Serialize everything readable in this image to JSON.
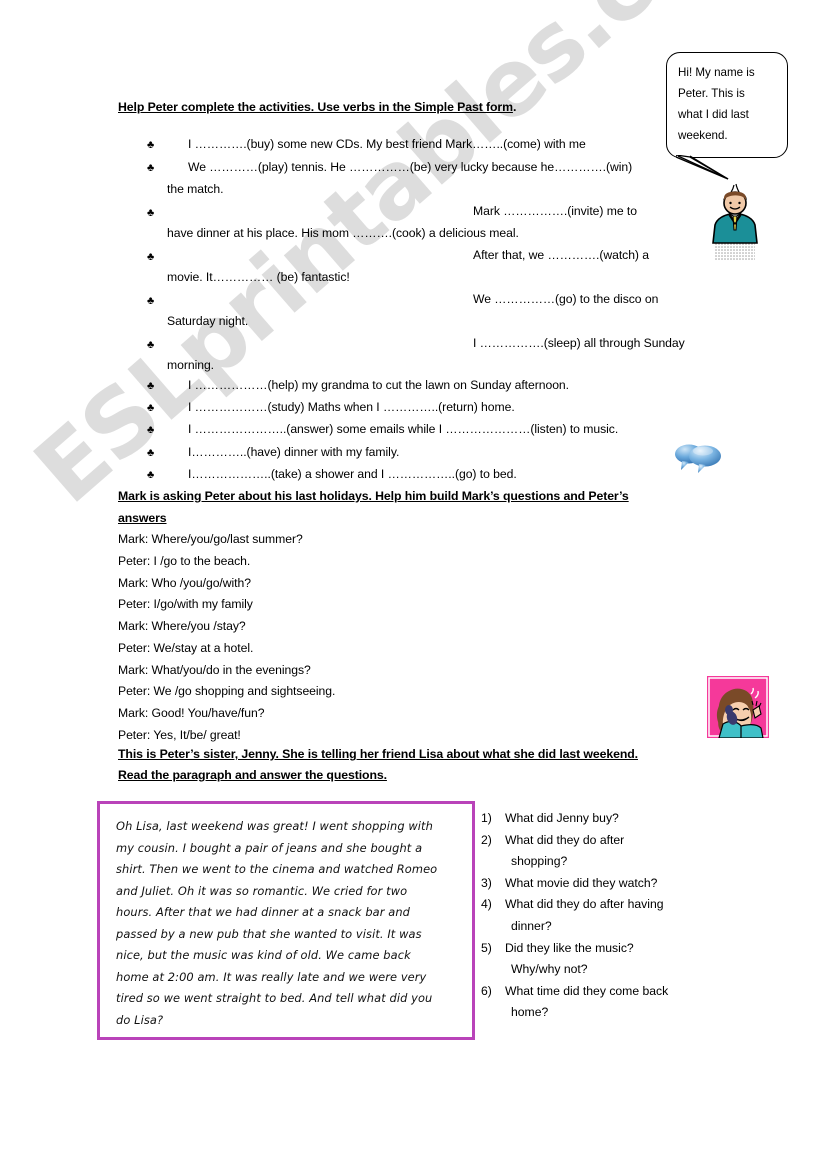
{
  "speech_bubble": {
    "name": "peter-intro-bubble",
    "lines": [
      "Hi! My name is",
      "Peter. This is",
      "what I did last",
      "weekend."
    ]
  },
  "section1": {
    "heading_underlined": "Help Peter complete the activities. Use verbs in the Simple Past form",
    "heading_tail": ".",
    "bullet_glyph": "♣",
    "items": [
      {
        "indent": "left",
        "lines": [
          "I ………….(buy) some new CDs. My best friend Mark……..(come) with me"
        ]
      },
      {
        "indent": "left",
        "lines": [
          "We …………(play) tennis. He ……………(be) very lucky because he………….(win)",
          "the match."
        ]
      },
      {
        "indent": "right",
        "lines": [
          "Mark …………….(invite) me to",
          "have dinner at his place.  His mom ……….(cook) a delicious meal."
        ]
      },
      {
        "indent": "right",
        "lines": [
          "After that, we ………….(watch) a",
          "movie. It…………… (be) fantastic!"
        ]
      },
      {
        "indent": "right",
        "lines": [
          "We ……………(go) to the disco on",
          "Saturday night."
        ]
      },
      {
        "indent": "right",
        "lines": [
          "I …………….(sleep) all through Sunday",
          "morning."
        ]
      },
      {
        "indent": "left",
        "lines": [
          "I ………………(help) my grandma to cut the lawn on Sunday  afternoon."
        ]
      },
      {
        "indent": "left",
        "lines": [
          "I ………………(study) Maths when I …………..(return) home."
        ]
      },
      {
        "indent": "left",
        "lines": [
          "I …………………..(answer) some emails while I …………………(listen) to music."
        ]
      },
      {
        "indent": "left",
        "lines": [
          "I…………..(have) dinner with my family."
        ]
      },
      {
        "indent": "left",
        "lines": [
          "I………………..(take) a shower and I ……………..(go) to bed."
        ]
      }
    ]
  },
  "section2": {
    "heading_line1": "Mark is asking Peter about his last holidays. Help him build Mark’s questions and Peter’s",
    "heading_line2": "answers",
    "dialogue": [
      "Mark: Where/you/go/last summer?",
      "Peter: I /go to the beach.",
      "Mark: Who /you/go/with?",
      "Peter: I/go/with my family",
      "Mark: Where/you /stay?",
      "Peter: We/stay at a hotel.",
      "Mark: What/you/do in the evenings?",
      "Peter: We /go shopping and sightseeing.",
      "Mark: Good! You/have/fun?",
      "Peter: Yes, It/be/ great!"
    ]
  },
  "section3": {
    "heading_line1": "This is Peter’s sister, Jenny. She is telling her friend Lisa about what she did last weekend.",
    "heading_line2": "Read the paragraph and answer the questions.",
    "paragraph_lines": [
      "Oh Lisa, last weekend was great! I went shopping with",
      "my cousin. I bought a pair of jeans and she bought a",
      "shirt. Then we went to the cinema and watched Romeo",
      "and Juliet. Oh it was so romantic.  We cried for two",
      "hours. After that we had dinner at a snack bar and",
      "passed by a new pub that she wanted to visit. It was",
      "nice, but the music was kind of old. We came back",
      "home at 2:00 am. It was really late and we were very",
      "tired so we went straight to bed. And tell what did you",
      "do Lisa?"
    ],
    "questions": [
      {
        "num": "1)",
        "lines": [
          "What did Jenny buy?"
        ]
      },
      {
        "num": "2)",
        "lines": [
          "What did they do after",
          "shopping?"
        ]
      },
      {
        "num": "3)",
        "lines": [
          "What movie did they watch?"
        ]
      },
      {
        "num": "4)",
        "lines": [
          "What did they do after having",
          "dinner?"
        ]
      },
      {
        "num": "5)",
        "lines": [
          "Did they like the music?",
          "Why/why not?"
        ]
      },
      {
        "num": "6)",
        "lines": [
          "What time did they come back",
          "home?"
        ]
      }
    ]
  },
  "watermark": {
    "text": "ESLprintables.com"
  },
  "colors": {
    "box_border": "#b943b9",
    "watermark": "#d2d2d2",
    "boy_jacket": "#1b8f98",
    "boy_tie": "#e8d34a",
    "girl_bg": "#f5399a",
    "chat_bubble": "#4f9bd8"
  }
}
